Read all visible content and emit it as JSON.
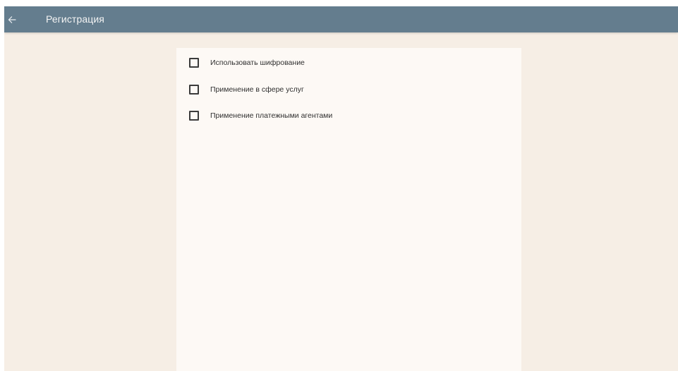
{
  "app_bar": {
    "back_icon": "arrow-left-icon",
    "title": "Регистрация",
    "color": "#647d8e"
  },
  "options": [
    {
      "label": "Использовать шифрование",
      "checked": false
    },
    {
      "label": "Применение в сфере услуг",
      "checked": false
    },
    {
      "label": "Применение платежными агентами",
      "checked": false
    }
  ],
  "colors": {
    "background": "#f6eee5",
    "card": "#fdf9f5"
  }
}
